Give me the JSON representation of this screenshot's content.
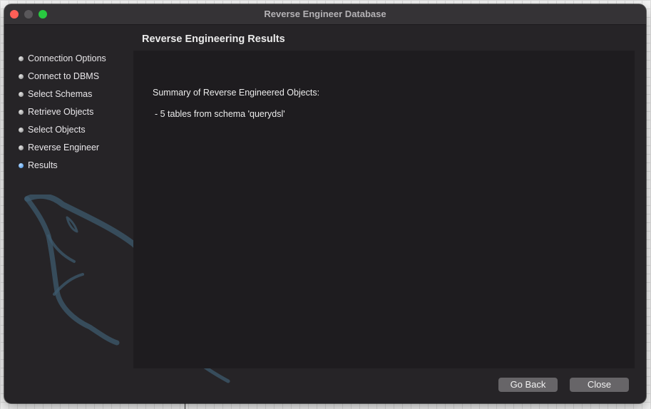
{
  "window": {
    "title": "Reverse Engineer Database"
  },
  "sidebar": {
    "steps": [
      {
        "label": "Connection Options",
        "state": "done"
      },
      {
        "label": "Connect to DBMS",
        "state": "done"
      },
      {
        "label": "Select Schemas",
        "state": "done"
      },
      {
        "label": "Retrieve Objects",
        "state": "done"
      },
      {
        "label": "Select Objects",
        "state": "done"
      },
      {
        "label": "Reverse Engineer",
        "state": "done"
      },
      {
        "label": "Results",
        "state": "current"
      }
    ],
    "watermark_icon": "mysql-dolphin-icon"
  },
  "main": {
    "title": "Reverse Engineering Results",
    "summary_heading": "Summary of Reverse Engineered Objects:",
    "summary_items": [
      " - 5 tables from schema 'querydsl'"
    ]
  },
  "buttons": {
    "back_label": "Go Back",
    "close_label": "Close"
  },
  "colors": {
    "window_background": "#262427",
    "content_background": "#1e1c1f",
    "current_step_bullet": "#3f8fe3",
    "button_background": "#676568",
    "traffic_close": "#ff5f57",
    "traffic_zoom": "#28c840"
  }
}
